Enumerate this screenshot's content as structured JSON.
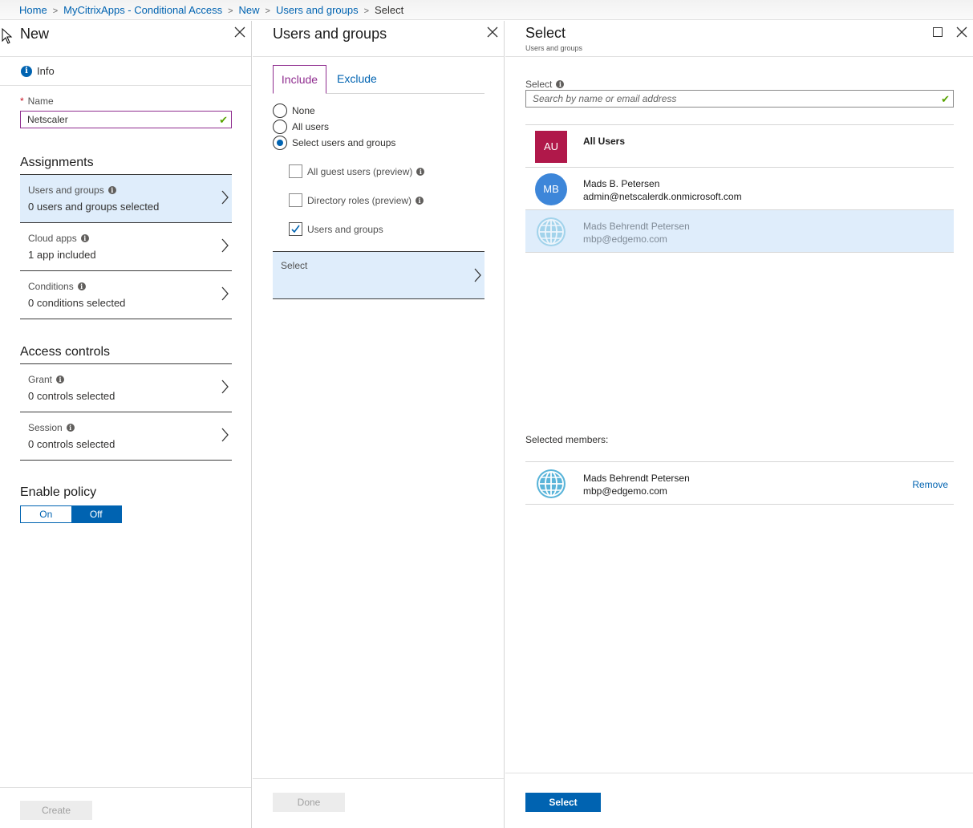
{
  "breadcrumb": {
    "items": [
      "Home",
      "MyCitrixApps - Conditional Access",
      "New",
      "Users and groups"
    ],
    "current": "Select"
  },
  "blade_new": {
    "title": "New",
    "info_label": "Info",
    "name_label": "Name",
    "name_value": "Netscaler",
    "assignments_heading": "Assignments",
    "assignments": [
      {
        "title": "Users and groups",
        "value": "0 users and groups selected"
      },
      {
        "title": "Cloud apps",
        "value": "1 app included"
      },
      {
        "title": "Conditions",
        "value": "0 conditions selected"
      }
    ],
    "access_heading": "Access controls",
    "access": [
      {
        "title": "Grant",
        "value": "0 controls selected"
      },
      {
        "title": "Session",
        "value": "0 controls selected"
      }
    ],
    "enable_heading": "Enable policy",
    "toggle_on": "On",
    "toggle_off": "Off",
    "create_button": "Create"
  },
  "blade_users": {
    "title": "Users and groups",
    "tab_include": "Include",
    "tab_exclude": "Exclude",
    "radios": [
      "None",
      "All users",
      "Select users and groups"
    ],
    "checkboxes": [
      {
        "label": "All guest users (preview)",
        "checked": false
      },
      {
        "label": "Directory roles (preview)",
        "checked": false
      },
      {
        "label": "Users and groups",
        "checked": true
      }
    ],
    "select_label": "Select",
    "done_button": "Done"
  },
  "blade_select": {
    "title": "Select",
    "subtitle": "Users and groups",
    "search_label": "Select",
    "search_placeholder": "Search by name or email address",
    "users": [
      {
        "initials": "AU",
        "name": "All Users",
        "email": ""
      },
      {
        "initials": "MB",
        "name": "Mads B. Petersen",
        "email": "admin@netscalerdk.onmicrosoft.com"
      },
      {
        "initials": "",
        "name": "Mads Behrendt Petersen",
        "email": "mbp@edgemo.com"
      }
    ],
    "selected_members_label": "Selected members:",
    "selected_member": {
      "name": "Mads Behrendt Petersen",
      "email": "mbp@edgemo.com"
    },
    "remove_label": "Remove",
    "select_button": "Select"
  },
  "colors": {
    "accent": "#0063b1",
    "selected_bg": "#dfedfb",
    "include_tab": "#8f2d8f",
    "avatar_au": "#b0184a",
    "avatar_mb": "#3d86d9"
  }
}
